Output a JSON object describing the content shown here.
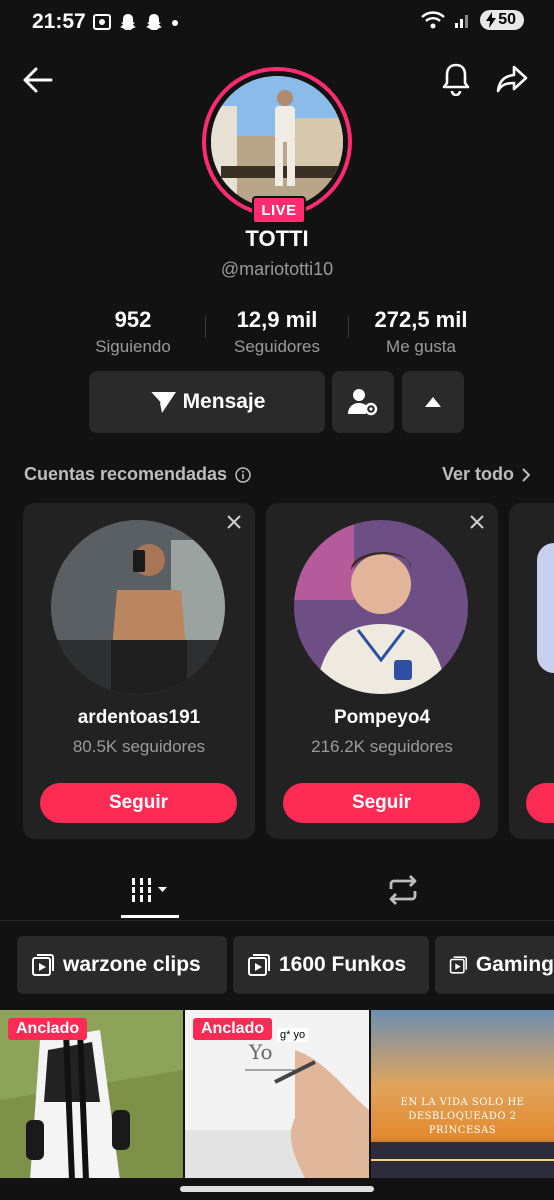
{
  "status_bar": {
    "time": "21:57",
    "battery": "50"
  },
  "profile": {
    "live_badge": "LIVE",
    "display_name": "TOTTI",
    "username": "@mariototti10",
    "stats": [
      {
        "value": "952",
        "label": "Siguiendo"
      },
      {
        "value": "12,9 mil",
        "label": "Seguidores"
      },
      {
        "value": "272,5 mil",
        "label": "Me gusta"
      }
    ]
  },
  "actions": {
    "message_label": "Mensaje"
  },
  "recommended": {
    "title": "Cuentas recomendadas",
    "see_all": "Ver todo",
    "accounts": [
      {
        "username": "ardentoas191",
        "followers": "80.5K seguidores",
        "follow_label": "Seguir"
      },
      {
        "username": "Pompeyo4",
        "followers": "216.2K seguidores",
        "follow_label": "Seguir"
      }
    ]
  },
  "playlists": [
    {
      "label": "warzone clips"
    },
    {
      "label": "1600 Funkos"
    },
    {
      "label": "Gaming"
    }
  ],
  "videos": [
    {
      "pinned_label": "Anclado"
    },
    {
      "pinned_label": "Anclado",
      "caption": "g* yo",
      "handwriting": "Yo"
    },
    {
      "overlay_text": "En la vida solo he desbloqueado 2 princesas"
    }
  ],
  "colors": {
    "accent": "#fe2c55",
    "ring": "#ff2d6f",
    "background": "#121212",
    "card": "#222222"
  }
}
